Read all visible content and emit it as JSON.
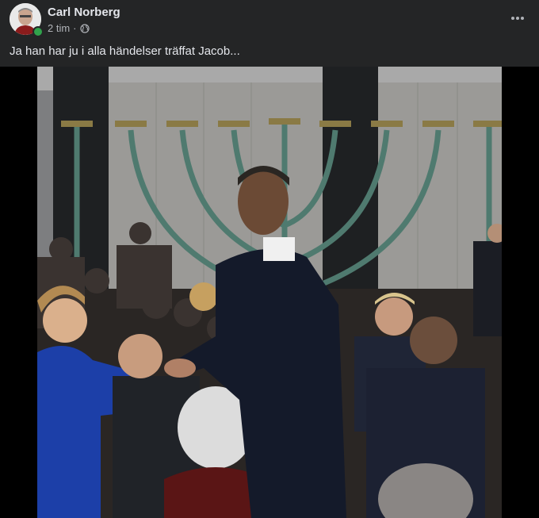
{
  "post": {
    "author": "Carl Norberg",
    "time": "2 tim",
    "separator": "·",
    "audience_icon": "globe-icon",
    "more_icon": "more-horizontal-icon",
    "caption": "Ja han har ju i alla händelser träffat Jacob...",
    "online": true
  },
  "colors": {
    "background": "#242526",
    "primary_text": "#e4e6eb",
    "secondary_text": "#b0b3b8",
    "online": "#31a24c"
  }
}
